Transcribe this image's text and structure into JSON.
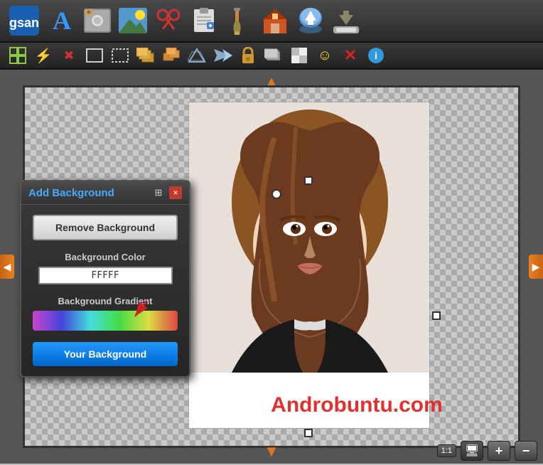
{
  "toolbar": {
    "icons": [
      "🅰",
      "🖼",
      "🌅",
      "✂",
      "📋",
      "🖌",
      "🏠",
      "📦",
      "📨"
    ]
  },
  "toolbar2": {
    "icons": [
      "⚙",
      "⚡",
      "🔴",
      "▭",
      "◻",
      "▦",
      "▷",
      "🔒",
      "▒",
      "☺",
      "❌",
      "ℹ"
    ]
  },
  "panel": {
    "title": "Add Background",
    "close_icon": "×",
    "settings_icon": "⊞",
    "remove_bg_label": "Remove Background",
    "bg_color_label": "Background Color",
    "bg_color_value": "FFFFF",
    "bg_gradient_label": "Background Gradient",
    "your_bg_label": "Your Background"
  },
  "canvas": {
    "watermark": "Androbuntu.com",
    "arrow_left": "◀",
    "arrow_right": "▶",
    "arrow_top": "▲",
    "arrow_bottom": "▼"
  },
  "bottom_controls": {
    "ratio_label": "1:1",
    "monitor_icon": "🖥",
    "zoom_in": "+",
    "zoom_out": "−"
  }
}
